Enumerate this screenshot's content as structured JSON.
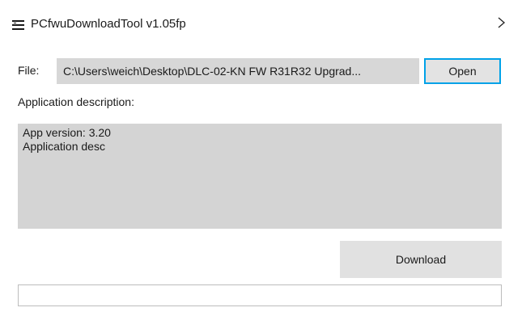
{
  "window": {
    "title": "PCfwuDownloadTool v1.05fp",
    "close_glyph": "✕",
    "app_icon": "app-menu-icon",
    "close_icon": "close-icon"
  },
  "file": {
    "label": "File:",
    "path": "C:\\Users\\weich\\Desktop\\DLC-02-KN FW R31R32 Upgrad...",
    "open_label": "Open",
    "open_border_color": "#00a2e8"
  },
  "description": {
    "label": "Application description:",
    "lines": [
      "App version: 3.20",
      "Application desc"
    ]
  },
  "download": {
    "label": "Download"
  },
  "progress": {
    "value": 0
  }
}
